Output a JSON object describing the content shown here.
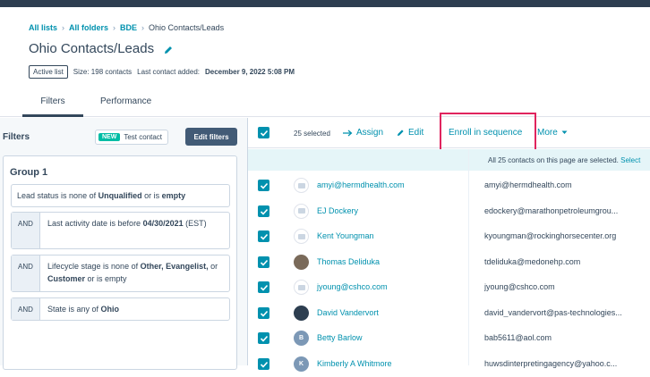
{
  "breadcrumbs": {
    "all_lists": "All lists",
    "all_folders": "All folders",
    "bde": "BDE",
    "current": "Ohio Contacts/Leads",
    "sep": "›"
  },
  "page": {
    "title": "Ohio Contacts/Leads",
    "active_badge": "Active list",
    "size": "Size: 198 contacts",
    "last_added_label": "Last contact added:",
    "last_added_value": "December 9, 2022 5:08 PM"
  },
  "tabs": {
    "filters": "Filters",
    "performance": "Performance"
  },
  "filters_panel": {
    "heading": "Filters",
    "new_badge": "NEW",
    "test_contact": "Test contact",
    "edit_filters": "Edit filters",
    "group_title": "Group 1",
    "conditions": [
      {
        "and": "",
        "p1": "Lead status",
        "p2": " is none of ",
        "p3": "Unqualified",
        "p4": " or is ",
        "p5": "empty",
        "p6": ""
      },
      {
        "and": "AND",
        "p1": "Last activity date",
        "p2": " is before ",
        "p3": "04/30/2021",
        "p4": " ",
        "p5": "(EST)",
        "p6": ""
      },
      {
        "and": "AND",
        "p1": "Lifecycle stage",
        "p2": " is none of ",
        "p3": "Other, Evangelist,",
        "p4": " or ",
        "p5": "Customer",
        "p6": " or is empty"
      },
      {
        "and": "AND",
        "p1": "State",
        "p2": " is any of ",
        "p3": "Ohio",
        "p4": "",
        "p5": "",
        "p6": ""
      }
    ]
  },
  "toolbar": {
    "selected": "25 selected",
    "assign": "Assign",
    "edit": "Edit",
    "enroll": "Enroll in sequence",
    "more": "More"
  },
  "selection_msg": {
    "text": "All 25 contacts on this page are selected.",
    "link": "Select"
  },
  "contacts": [
    {
      "email": "amyi@hermdhealth.com",
      "email2": "amyi@hermdhealth.com",
      "avatar": "logo",
      "color": "#ffffff"
    },
    {
      "email": "EJ Dockery",
      "email2": "edockery@marathonpetroleumgrou...",
      "avatar": "logo",
      "color": "#ffffff"
    },
    {
      "email": "Kent Youngman",
      "email2": "kyoungman@rockinghorsecenter.org",
      "avatar": "logo",
      "color": "#ffffff"
    },
    {
      "email": "Thomas Deliduka",
      "email2": "tdeliduka@medonehp.com",
      "avatar": "photo",
      "color": "#7a6a5a"
    },
    {
      "email": "jyoung@cshco.com",
      "email2": "jyoung@cshco.com",
      "avatar": "logo",
      "color": "#ffffff"
    },
    {
      "email": "David Vandervort",
      "email2": "david_vandervort@pas-technologies...",
      "avatar": "photo",
      "color": "#2d3e50"
    },
    {
      "email": "Betty Barlow",
      "email2": "bab5611@aol.com",
      "avatar": "B",
      "color": "#7c98b6"
    },
    {
      "email": "Kimberly A Whitmore",
      "email2": "huwsdinterpretingagency@yahoo.c...",
      "avatar": "K",
      "color": "#7c98b6"
    }
  ]
}
